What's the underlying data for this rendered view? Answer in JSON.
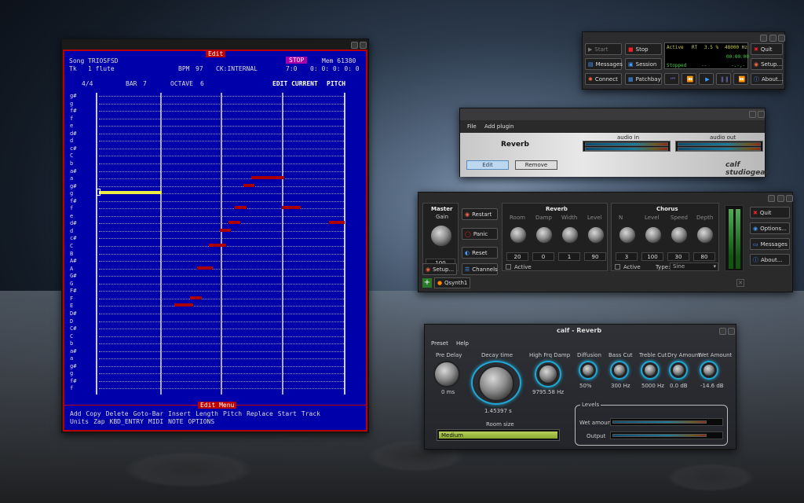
{
  "edit_window": {
    "title": "Edit",
    "song_label": "Song TRIOSFSD",
    "tk_label": "Tk",
    "tk_value": "1 flute",
    "bpm_label": "BPM",
    "bpm_value": "97",
    "ck_label": "CK:INTERNAL",
    "stop_label": "STOP",
    "mem_label": "Mem 61380",
    "pos1": "7:0",
    "pos2": "0: 0: 0: 0: 0",
    "sig": "4/4",
    "bar_label": "BAR",
    "bar_value": "7",
    "octave_label": "OCTAVE",
    "octave_value": "6",
    "edit_current": "EDIT CURRENT",
    "pitch_label": "PITCH",
    "notes": [
      "g#",
      "g",
      "f#",
      "f",
      "e",
      "d#",
      "d",
      "c#",
      "C",
      "b",
      "a#",
      "a",
      "g#",
      "g",
      "f#",
      "f",
      "e",
      "d#",
      "d",
      "c#",
      "C",
      "B",
      "A#",
      "A",
      "G#",
      "G",
      "F#",
      "F",
      "E",
      "D#",
      "D",
      "C#",
      "C",
      "b",
      "a#",
      "a",
      "g#",
      "g",
      "f#",
      "f"
    ],
    "menu_title": "Edit Menu",
    "menu_row1": [
      "Add",
      "Copy",
      "Delete",
      "Goto-Bar",
      "Insert",
      "Length",
      "Pitch",
      "Replace",
      "Start",
      "Track"
    ],
    "menu_row2": [
      "Units",
      "Zap",
      "KBD_ENTRY",
      "MIDI",
      "NOTE",
      "OPTIONS"
    ]
  },
  "qjack": {
    "start": "Start",
    "stop": "Stop",
    "quit": "Quit",
    "messages": "Messages",
    "session": "Session",
    "setup": "Setup...",
    "connect": "Connect",
    "patchbay": "Patchbay",
    "about": "About...",
    "status_active": "Active",
    "status_rt": "RT",
    "status_pct": "3.5 %",
    "status_hz": "48000 Hz",
    "status_time1": "00:00:00",
    "status_stopped": "Stopped",
    "status_dashes": "--",
    "status_time2": "-.-,--"
  },
  "studiogear": {
    "menu": [
      "File",
      "Add plugin"
    ],
    "plugin_name": "Reverb",
    "audio_in": "audio in",
    "audio_out": "audio out",
    "edit_btn": "Edit",
    "remove_btn": "Remove",
    "logo": "calf studiogear"
  },
  "qsynth": {
    "master_label": "Master",
    "gain_label": "Gain",
    "gain_value": "100",
    "restart": "Restart",
    "panic": "Panic",
    "reset": "Reset",
    "setup": "Setup...",
    "channels": "Channels",
    "reverb_title": "Reverb",
    "reverb_labels": [
      "Room",
      "Damp",
      "Width",
      "Level"
    ],
    "reverb_values": [
      "20",
      "0",
      "1",
      "90"
    ],
    "chorus_title": "Chorus",
    "chorus_labels": [
      "N",
      "Level",
      "Speed",
      "Depth"
    ],
    "chorus_values": [
      "3",
      "100",
      "30",
      "80"
    ],
    "active_label": "Active",
    "type_label": "Type:",
    "type_value": "Sine",
    "quit": "Quit",
    "options": "Options...",
    "messages": "Messages",
    "about": "About...",
    "tab": "Qsynth1"
  },
  "calf_reverb": {
    "title": "calf - Reverb",
    "menu": [
      "Preset",
      "Help"
    ],
    "pre_delay_label": "Pre Delay",
    "pre_delay_value": "0 ms",
    "decay_label": "Decay time",
    "decay_value": "1.45397 s",
    "hfd_label": "High Frq Damp",
    "hfd_value": "9795.58 Hz",
    "diffusion_label": "Diffusion",
    "diffusion_value": "50%",
    "basscut_label": "Bass Cut",
    "basscut_value": "300 Hz",
    "treblecut_label": "Treble Cut",
    "treblecut_value": "5000 Hz",
    "dry_label": "Dry Amount",
    "dry_value": "0.0 dB",
    "wet_label": "Wet Amount",
    "wet_value": "-14.6 dB",
    "room_size_label": "Room size",
    "room_size_value": "Medium",
    "levels_label": "Levels",
    "wet_amount_label": "Wet amount",
    "output_label": "Output"
  }
}
